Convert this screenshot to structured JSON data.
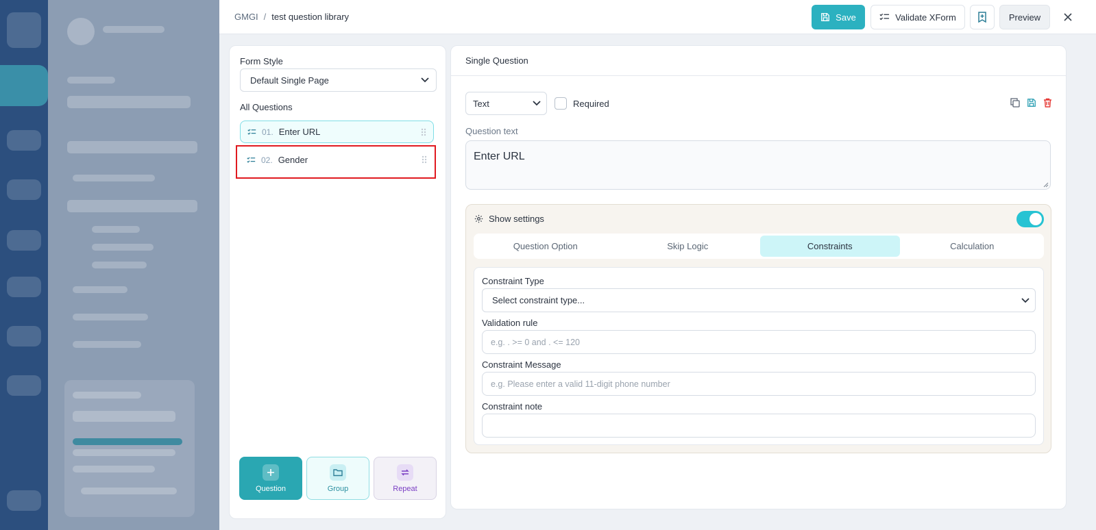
{
  "breadcrumb": {
    "org": "GMGI",
    "separator": "/",
    "library": "test question library"
  },
  "toolbar": {
    "save_label": "Save",
    "validate_label": "Validate XForm",
    "preview_label": "Preview"
  },
  "left_panel": {
    "form_style_label": "Form Style",
    "form_style_value": "Default Single Page",
    "all_questions_label": "All Questions",
    "questions": [
      {
        "number": "01.",
        "label": "Enter URL"
      },
      {
        "number": "02.",
        "label": "Gender"
      }
    ],
    "add_buttons": {
      "question": "Question",
      "group": "Group",
      "repeat": "Repeat"
    }
  },
  "editor": {
    "header": "Single Question",
    "type_value": "Text",
    "required_label": "Required",
    "question_text_label": "Question text",
    "question_text_value": "Enter URL",
    "show_settings_label": "Show settings",
    "tabs": [
      "Question Option",
      "Skip Logic",
      "Constraints",
      "Calculation"
    ],
    "active_tab": "Constraints",
    "constraint_type_label": "Constraint Type",
    "constraint_type_value": "Select constraint type...",
    "validation_rule_label": "Validation rule",
    "validation_rule_placeholder": "e.g. . >= 0 and . <= 120",
    "constraint_message_label": "Constraint Message",
    "constraint_message_placeholder": "e.g. Please enter a valid 11-digit phone number",
    "constraint_note_label": "Constraint note"
  },
  "colors": {
    "accent": "#2cb1c0",
    "toggle_on": "#27c3d3",
    "highlight": "#e0191f",
    "delete": "#e53935"
  }
}
